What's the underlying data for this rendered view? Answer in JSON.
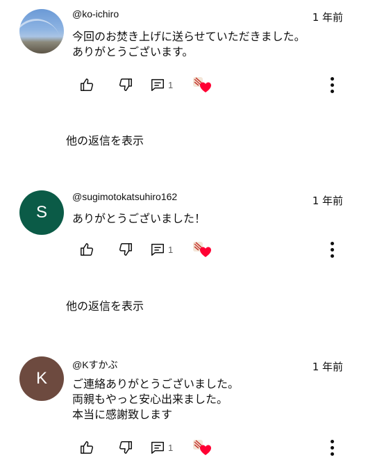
{
  "comments": [
    {
      "handle": "@ko-ichiro",
      "time": "1 年前",
      "text": "今回のお焚き上げに送らせていただきました。\nありがとうございます。",
      "avatar_type": "photo",
      "avatar_letter": "",
      "avatar_color": "#7aa4d8",
      "reply_count": "1",
      "show_replies_label": "他の返信を表示"
    },
    {
      "handle": "@sugimotokatsuhiro162",
      "time": "1 年前",
      "text": "ありがとうございました！",
      "avatar_type": "letter",
      "avatar_letter": "S",
      "avatar_color": "#0b5b47",
      "reply_count": "1",
      "show_replies_label": "他の返信を表示"
    },
    {
      "handle": "@Kすかぶ",
      "time": "1 年前",
      "text": "ご連絡ありがとうございました。\n両親もやっと安心出来ました。\n本当に感謝致します",
      "avatar_type": "letter",
      "avatar_letter": "K",
      "avatar_color": "#6d4a3f",
      "reply_count": "1",
      "show_replies_label": ""
    }
  ],
  "icons": {
    "like": "thumbs-up-icon",
    "dislike": "thumbs-down-icon",
    "reply": "comment-icon",
    "creator_heart": "creator-heart-icon",
    "more": "more-vertical-icon"
  },
  "colors": {
    "text": "#0f0f0f",
    "secondary_text": "#606060",
    "heart": "#ff0033"
  }
}
